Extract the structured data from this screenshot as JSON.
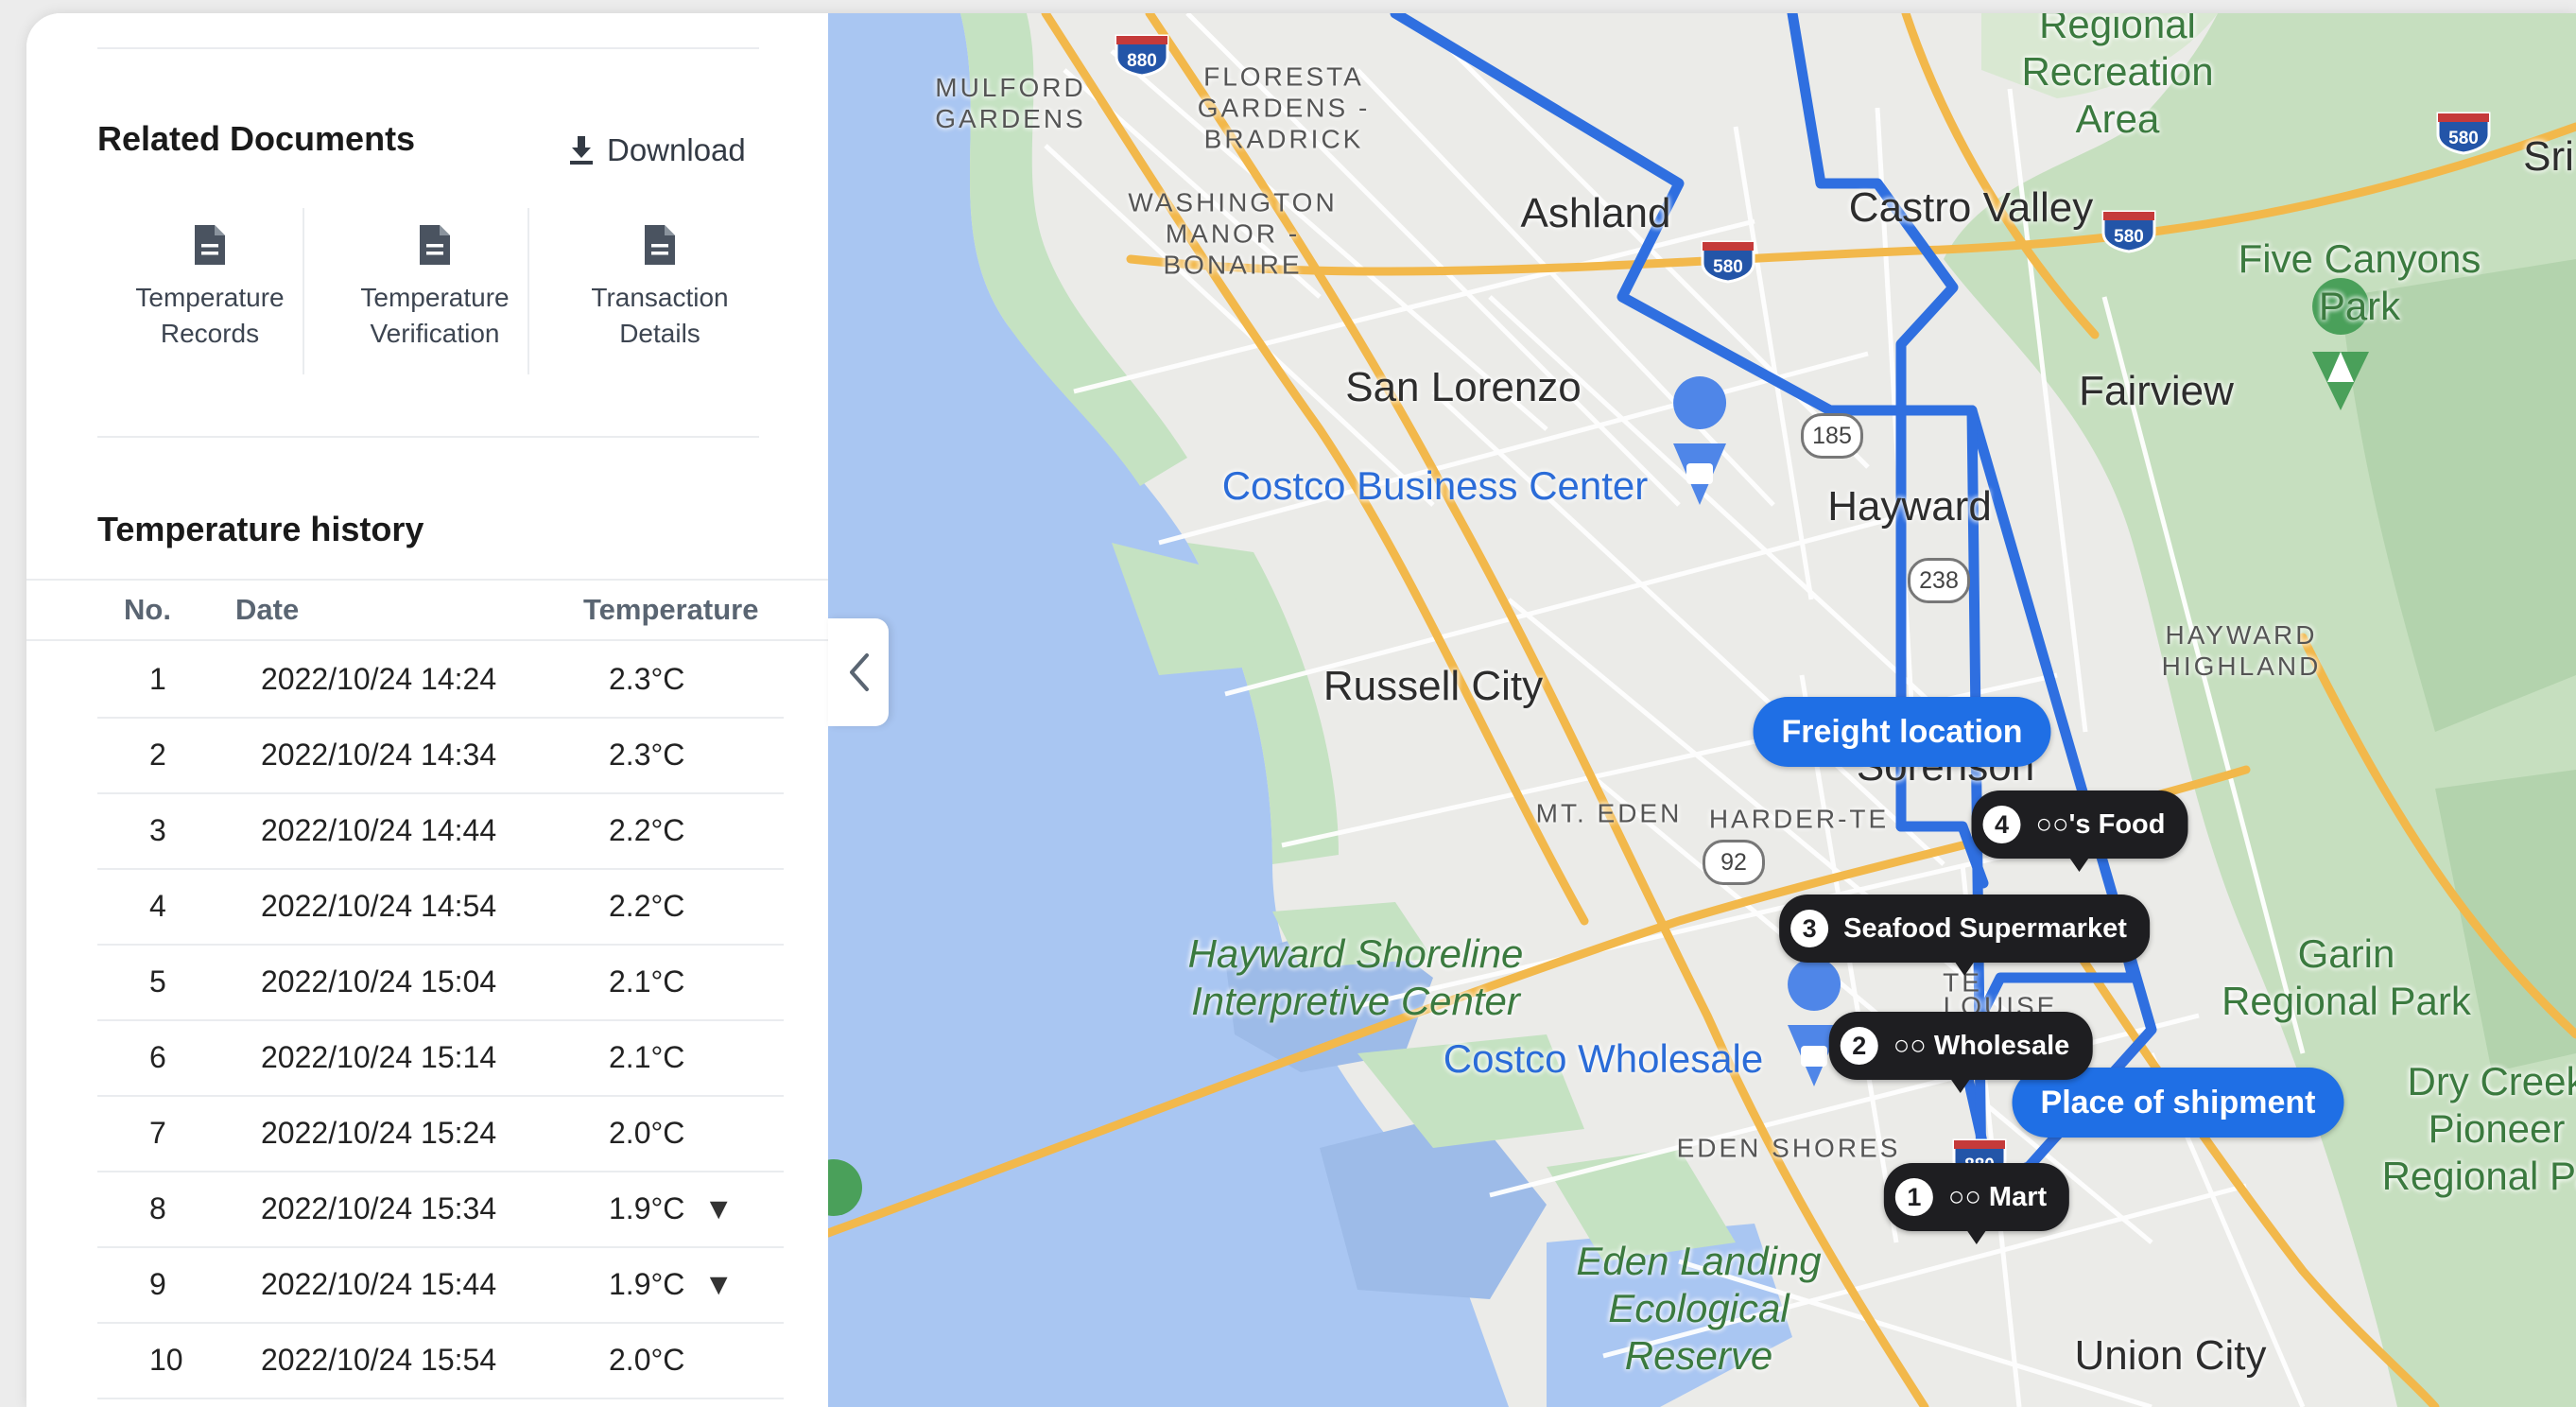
{
  "documents": {
    "title": "Related Documents",
    "download_label": "Download",
    "items": [
      {
        "label": "Temperature\nRecords",
        "icon": "document-icon"
      },
      {
        "label": "Temperature\nVerification",
        "icon": "document-icon"
      },
      {
        "label": "Transaction\nDetails",
        "icon": "document-icon"
      }
    ]
  },
  "history": {
    "title": "Temperature history",
    "columns": [
      "No.",
      "Date",
      "Temperature"
    ],
    "rows": [
      {
        "no": "1",
        "date": "2022/10/24 14:24",
        "temp": "2.3°C",
        "arrow": ""
      },
      {
        "no": "2",
        "date": "2022/10/24 14:34",
        "temp": "2.3°C",
        "arrow": ""
      },
      {
        "no": "3",
        "date": "2022/10/24 14:44",
        "temp": "2.2°C",
        "arrow": ""
      },
      {
        "no": "4",
        "date": "2022/10/24 14:54",
        "temp": "2.2°C",
        "arrow": ""
      },
      {
        "no": "5",
        "date": "2022/10/24 15:04",
        "temp": "2.1°C",
        "arrow": ""
      },
      {
        "no": "6",
        "date": "2022/10/24 15:14",
        "temp": "2.1°C",
        "arrow": ""
      },
      {
        "no": "7",
        "date": "2022/10/24 15:24",
        "temp": "2.0°C",
        "arrow": ""
      },
      {
        "no": "8",
        "date": "2022/10/24 15:34",
        "temp": "1.9°C",
        "arrow": "▼"
      },
      {
        "no": "9",
        "date": "2022/10/24 15:44",
        "temp": "1.9°C",
        "arrow": "▼"
      },
      {
        "no": "10",
        "date": "2022/10/24 15:54",
        "temp": "2.0°C",
        "arrow": ""
      }
    ]
  },
  "map": {
    "places": {
      "mulford": "MULFORD\nGARDENS",
      "floresta": "FLORESTA\nGARDENS -\nBRADRICK",
      "washington": "WASHINGTON\nMANOR -\nBONAIRE",
      "ashland": "Ashland",
      "castro_valley": "Castro Valley",
      "regional_recreation": "Regional\nRecreation\nArea",
      "sri": "Sri",
      "five_canyons": "Five Canyons\nPark",
      "san_lorenzo": "San Lorenzo",
      "fairview": "Fairview",
      "costco_business": "Costco Business Center",
      "hayward": "Hayward",
      "hayward_highland": "HAYWARD\nHIGHLAND",
      "russell_city": "Russell City",
      "sorenson": "Sorenson",
      "mt_eden": "MT. EDEN",
      "harder_tennyson": "HARDER-TE",
      "shoreline": "Hayward Shoreline\nInterpretive Center",
      "garin": "Garin\nRegional Park",
      "costco_wholesale": "Costco Wholesale",
      "dry_creek": "Dry Creek\nPioneer\nRegional Par",
      "eden_shores": "EDEN SHORES",
      "eden_landing": "Eden Landing\nEcological\nReserve",
      "union_city": "Union City",
      "tennyson": "TE",
      "louise": "LOUISE"
    },
    "shields": [
      "880",
      "580",
      "580",
      "580",
      "238",
      "880"
    ],
    "state_routes": [
      "185",
      "238",
      "92",
      "238"
    ],
    "freight_label": "Freight location",
    "shipment_label": "Place of shipment",
    "stops": [
      {
        "num": "4",
        "name": "○○'s Food"
      },
      {
        "num": "3",
        "name": "Seafood Supermarket"
      },
      {
        "num": "2",
        "name": "○○ Wholesale"
      },
      {
        "num": "1",
        "name": "○○ Mart"
      }
    ],
    "colors": {
      "route": "#2f6fe0",
      "water": "#a9c6f2",
      "park": "#c5e2c2",
      "highway": "#f2b84b"
    }
  }
}
